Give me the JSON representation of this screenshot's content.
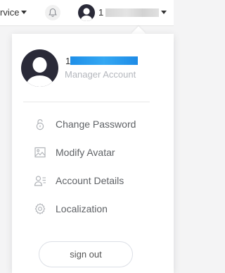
{
  "topbar": {
    "service_label": "rvice",
    "user_initial": "1"
  },
  "profile": {
    "name_prefix": "1",
    "role": "Manager Account"
  },
  "menu": [
    {
      "label": "Change Password",
      "icon": "lock-icon"
    },
    {
      "label": "Modify Avatar",
      "icon": "image-icon"
    },
    {
      "label": "Account Details",
      "icon": "user-details-icon"
    },
    {
      "label": "Localization",
      "icon": "gear-icon"
    }
  ],
  "signout_label": "sign out",
  "colors": {
    "avatar_bg": "#2a2a38",
    "name_highlight": "#2196f3",
    "role_text": "#b4b7bd",
    "menu_text": "#5f6266",
    "icon_stroke": "#b0b3b8"
  }
}
